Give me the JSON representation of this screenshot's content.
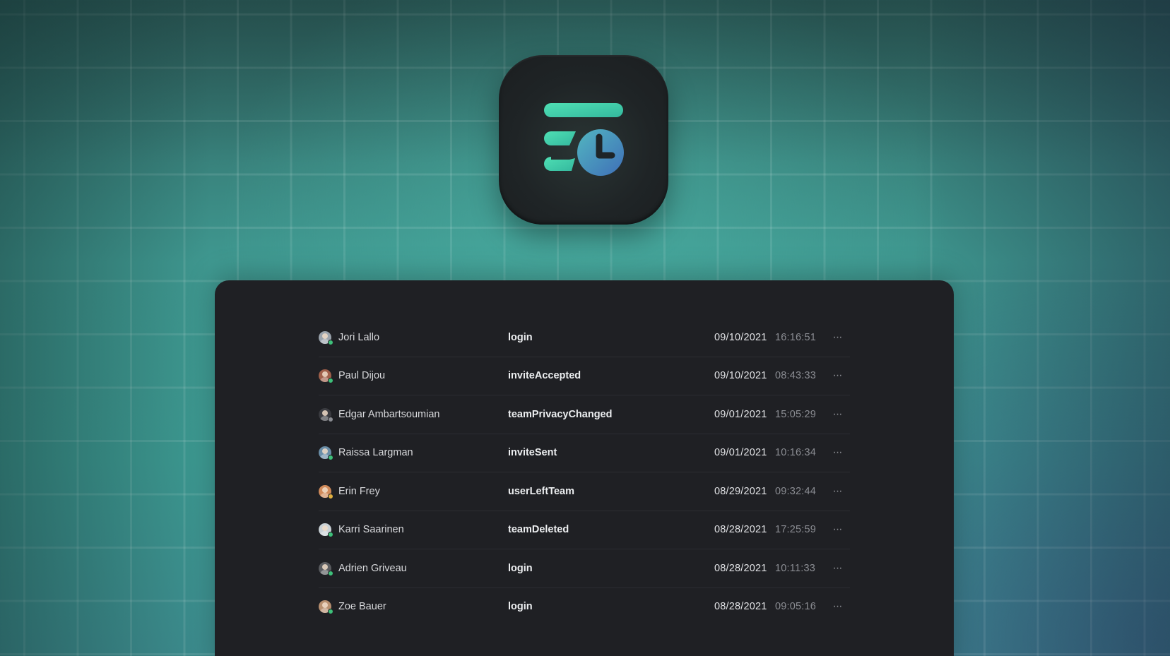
{
  "colors": {
    "status_online": "#3ec07a",
    "status_away": "#e0b040",
    "status_offline": "#8a8c92",
    "icon_teal": "#40d2aa",
    "icon_blue": "#4a86c8"
  },
  "app_icon": {
    "name": "activity-log-icon"
  },
  "rows": [
    {
      "user": "Jori Lallo",
      "avatar_color": "#9aa3ad",
      "status": "#3ec07a",
      "event": "login",
      "date": "09/10/2021",
      "time": "16:16:51",
      "more": "···"
    },
    {
      "user": "Paul Dijou",
      "avatar_color": "#a0604a",
      "status": "#3ec07a",
      "event": "inviteAccepted",
      "date": "09/10/2021",
      "time": "08:43:33",
      "more": "···"
    },
    {
      "user": "Edgar Ambartsoumian",
      "avatar_color": "#3a3b40",
      "status": "#8a8c92",
      "event": "teamPrivacyChanged",
      "date": "09/01/2021",
      "time": "15:05:29",
      "more": "···"
    },
    {
      "user": "Raissa Largman",
      "avatar_color": "#6a8ea8",
      "status": "#3ec07a",
      "event": "inviteSent",
      "date": "09/01/2021",
      "time": "10:16:34",
      "more": "···"
    },
    {
      "user": "Erin Frey",
      "avatar_color": "#d08a5a",
      "status": "#e0b040",
      "event": "userLeftTeam",
      "date": "08/29/2021",
      "time": "09:32:44",
      "more": "···"
    },
    {
      "user": "Karri Saarinen",
      "avatar_color": "#c9d1d6",
      "status": "#3ec07a",
      "event": "teamDeleted",
      "date": "08/28/2021",
      "time": "17:25:59",
      "more": "···"
    },
    {
      "user": "Adrien Griveau",
      "avatar_color": "#5a5c60",
      "status": "#3ec07a",
      "event": "login",
      "date": "08/28/2021",
      "time": "10:11:33",
      "more": "···"
    },
    {
      "user": "Zoe Bauer",
      "avatar_color": "#b89070",
      "status": "#3ec07a",
      "event": "login",
      "date": "08/28/2021",
      "time": "09:05:16",
      "more": "···"
    }
  ]
}
